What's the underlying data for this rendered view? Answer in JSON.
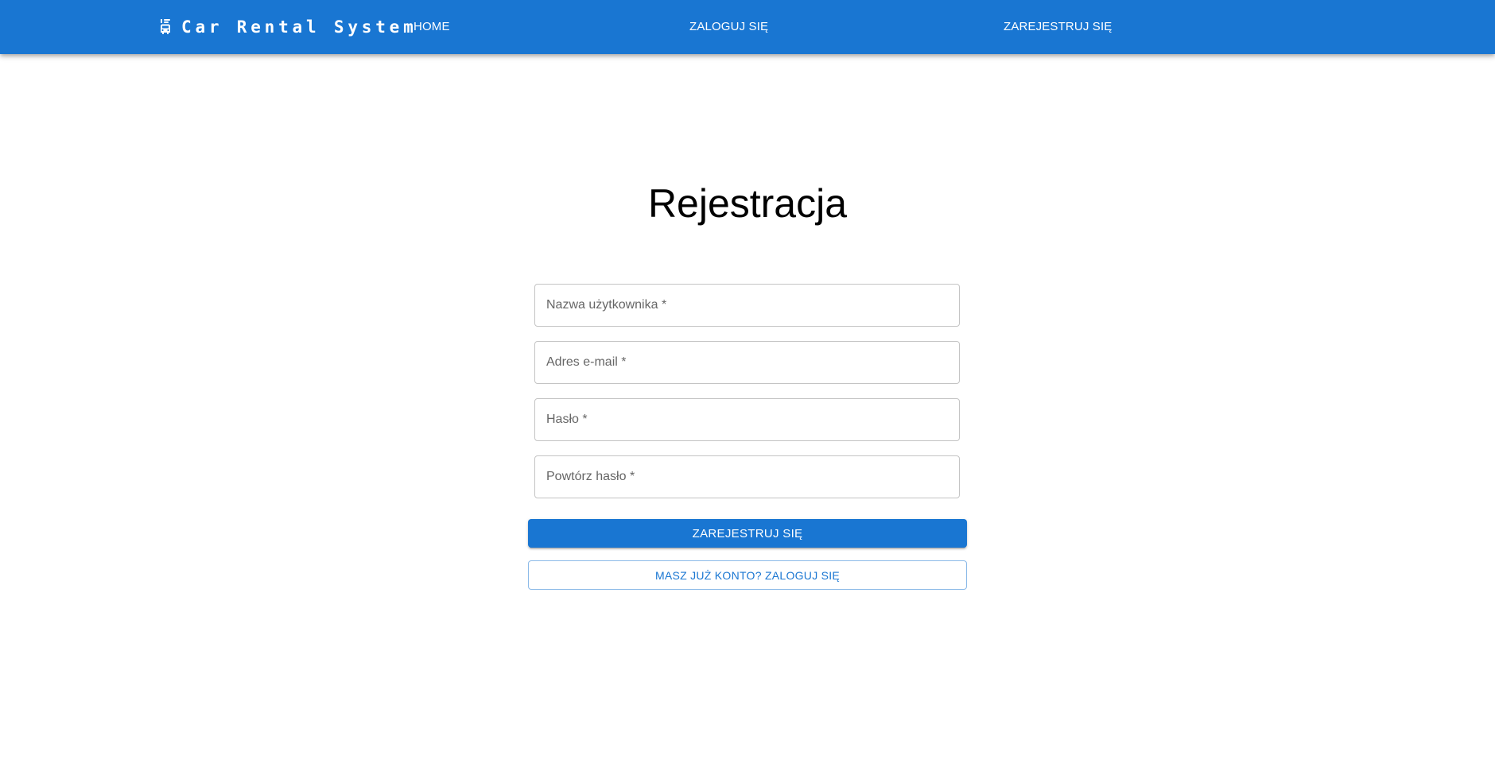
{
  "colors": {
    "primary": "#1976d2",
    "appbar_text": "#ffffff",
    "background": "#ffffff",
    "field_border": "#c4c4c4"
  },
  "navbar": {
    "brand_icon": "car-rental-icon",
    "brand": "Car Rental System",
    "home": "HOME",
    "login": "ZALOGUJ SIĘ",
    "register": "ZAREJESTRUJ SIĘ"
  },
  "form": {
    "title": "Rejestracja",
    "username": {
      "placeholder": "Nazwa użytkownika *",
      "value": ""
    },
    "email": {
      "placeholder": "Adres e-mail *",
      "value": ""
    },
    "password": {
      "placeholder": "Hasło *",
      "value": ""
    },
    "repeat_password": {
      "placeholder": "Powtórz hasło *",
      "value": ""
    },
    "submit": "ZAREJESTRUJ SIĘ",
    "login_link": "MASZ JUŻ KONTO? ZALOGUJ SIĘ"
  }
}
